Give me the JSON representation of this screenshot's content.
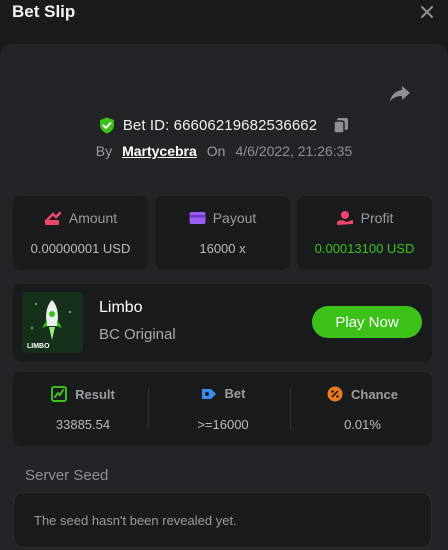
{
  "header": {
    "title": "Bet Slip"
  },
  "bet": {
    "id_label": "Bet ID: 66606219682536662",
    "by_label": "By",
    "user": "Martycebra",
    "on_label": "On",
    "date": "4/6/2022, 21:26:35"
  },
  "stats": {
    "amount": {
      "label": "Amount",
      "value": "0.00000001 USD"
    },
    "payout": {
      "label": "Payout",
      "value": "16000 x"
    },
    "profit": {
      "label": "Profit",
      "value": "0.00013100 USD"
    }
  },
  "game": {
    "name": "Limbo",
    "subtitle": "BC Original",
    "thumb_text": "LIMBO",
    "play_label": "Play Now"
  },
  "result": {
    "result": {
      "label": "Result",
      "value": "33885.54"
    },
    "bet": {
      "label": "Bet",
      "value": ">=16000"
    },
    "chance": {
      "label": "Chance",
      "value": "0.01%"
    }
  },
  "seed": {
    "label": "Server Seed",
    "text": "The seed hasn't been revealed yet."
  },
  "colors": {
    "accent_green": "#3bc117",
    "panel_bg": "#232427",
    "card_bg": "#1a1b1d"
  },
  "icons": [
    "close-icon",
    "share-icon",
    "shield-check-icon",
    "copy-icon",
    "amount-icon",
    "payout-icon",
    "profit-icon",
    "result-icon",
    "bet-icon",
    "chance-icon"
  ]
}
